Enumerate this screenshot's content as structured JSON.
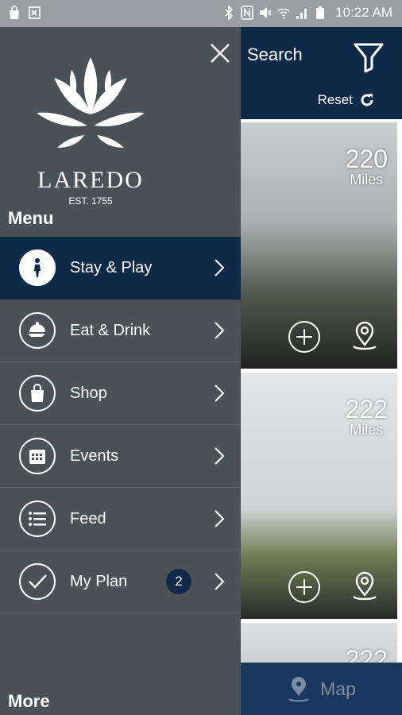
{
  "status_bar": {
    "time": "10:22 AM",
    "icons": [
      "shopping-bag-icon",
      "image-x-icon",
      "bluetooth-icon",
      "nfc-icon",
      "mute-icon",
      "wifi-icon",
      "signal-icon",
      "battery-icon"
    ]
  },
  "drawer": {
    "logo": {
      "name": "LAREDO",
      "est": "EST. 1755"
    },
    "menu_heading": "Menu",
    "items": [
      {
        "label": "Stay & Play",
        "icon": "walking-person-icon",
        "active": true
      },
      {
        "label": "Eat & Drink",
        "icon": "food-cloche-icon",
        "active": false
      },
      {
        "label": "Shop",
        "icon": "shopping-bag-icon",
        "active": false
      },
      {
        "label": "Events",
        "icon": "calendar-icon",
        "active": false
      },
      {
        "label": "Feed",
        "icon": "list-icon",
        "active": false
      },
      {
        "label": "My Plan",
        "icon": "checkmark-icon",
        "active": false,
        "badge": "2"
      }
    ],
    "more_heading": "More"
  },
  "content": {
    "search_label": "Search",
    "reset_label": "Reset",
    "cards": [
      {
        "distance": "220",
        "unit": "Miles"
      },
      {
        "distance": "222",
        "unit": "Miles"
      },
      {
        "distance": "222",
        "unit": ""
      }
    ],
    "map_label": "Map"
  },
  "colors": {
    "drawer_bg": "#4a5258",
    "navy": "#0f2a48",
    "map_bar": "#18385d"
  }
}
